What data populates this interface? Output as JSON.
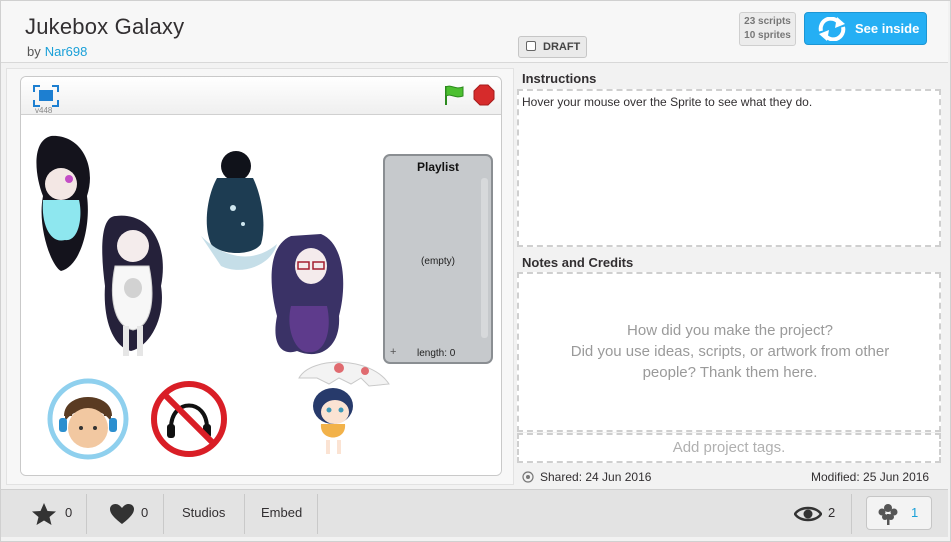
{
  "header": {
    "title": "Jukebox Galaxy",
    "by_label": "by",
    "author": "Nar698",
    "draft_label": "DRAFT",
    "scripts_count": "23 scripts",
    "sprites_count": "10 sprites",
    "see_inside_label": "See inside"
  },
  "player": {
    "version": "v448",
    "playlist": {
      "title": "Playlist",
      "empty_text": "(empty)",
      "length_label": "length: 0",
      "add_symbol": "+"
    }
  },
  "instructions": {
    "heading": "Instructions",
    "text": "Hover your mouse over the Sprite to see what they do."
  },
  "notes": {
    "heading": "Notes and Credits",
    "placeholder_line1": "How did you make the project?",
    "placeholder_line2": "Did you use ideas, scripts, or artwork from other",
    "placeholder_line3": "people? Thank them here."
  },
  "tags": {
    "placeholder": "Add project tags."
  },
  "dates": {
    "shared": "Shared: 24 Jun 2016",
    "modified": "Modified: 25 Jun 2016"
  },
  "footer": {
    "favorites": "0",
    "loves": "0",
    "studios_label": "Studios",
    "embed_label": "Embed",
    "views": "2",
    "remixes": "1"
  },
  "colors": {
    "accent": "#25aff4",
    "link": "#1aa0d8",
    "flag": "#4cbf30",
    "stop": "#d62b2b"
  }
}
